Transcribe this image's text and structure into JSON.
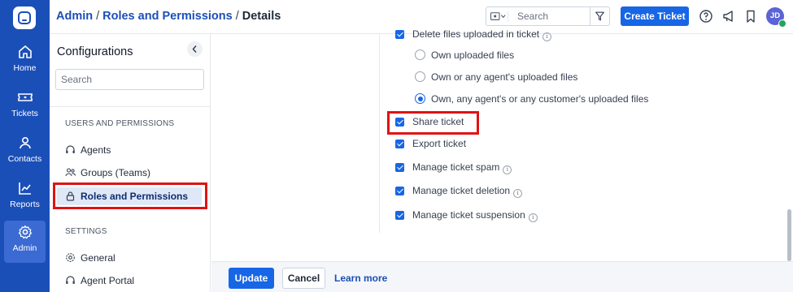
{
  "breadcrumb": {
    "admin": "Admin",
    "sep1": "/",
    "roles": "Roles and Permissions",
    "sep2": "/",
    "current": "Details"
  },
  "header": {
    "search_placeholder": "Search",
    "create_ticket": "Create Ticket",
    "avatar_initials": "JD"
  },
  "leftnav": {
    "items": [
      {
        "label": "Home",
        "icon": "home-icon"
      },
      {
        "label": "Tickets",
        "icon": "ticket-icon"
      },
      {
        "label": "Contacts",
        "icon": "person-icon"
      },
      {
        "label": "Reports",
        "icon": "chart-icon"
      },
      {
        "label": "Admin",
        "icon": "gear-icon",
        "active": true
      }
    ]
  },
  "config": {
    "title": "Configurations",
    "search_placeholder": "Search",
    "section_users": "USERS AND PERMISSIONS",
    "users_items": [
      "Agents",
      "Groups (Teams)",
      "Roles and Permissions"
    ],
    "section_settings": "SETTINGS",
    "settings_items": [
      "General",
      "Agent Portal"
    ]
  },
  "permissions": {
    "delete_files": "Delete files uploaded in ticket",
    "radio_options": [
      "Own uploaded files",
      "Own or any agent's uploaded files",
      "Own, any agent's or any customer's uploaded files"
    ],
    "radio_selected_index": 2,
    "checkboxes": [
      {
        "label": "Share ticket",
        "checked": true
      },
      {
        "label": "Export ticket",
        "checked": true
      },
      {
        "label": "Manage ticket spam",
        "checked": true
      },
      {
        "label": "Manage ticket deletion",
        "checked": true
      },
      {
        "label": "Manage ticket suspension",
        "checked": true
      }
    ]
  },
  "footer": {
    "update": "Update",
    "cancel": "Cancel",
    "learn_more": "Learn more"
  },
  "colors": {
    "nav": "#1b4fb8",
    "primary": "#1766e6",
    "highlight": "#e01313"
  }
}
